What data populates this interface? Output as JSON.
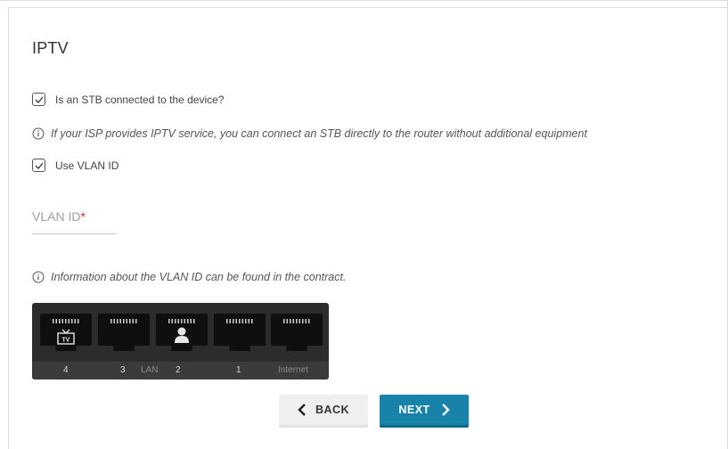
{
  "page": {
    "title": "IPTV"
  },
  "stb_option": {
    "label": "Is an STB connected to the device?",
    "checked": true
  },
  "isp_info": {
    "text": "If your ISP provides IPTV service, you can connect an STB directly to the router without additional equipment"
  },
  "vlan_option": {
    "label": "Use VLAN ID",
    "checked": true
  },
  "vlan_field": {
    "label": "VLAN ID",
    "required_mark": "*",
    "value": ""
  },
  "vlan_info": {
    "text": "Information about the VLAN ID can be found in the contract."
  },
  "ports": {
    "labels": {
      "p4": "4",
      "p3": "3",
      "lan": "LAN",
      "p2": "2",
      "p1": "1",
      "internet": "Internet"
    },
    "icons": {
      "p4": "tv-icon",
      "p2": "user-icon"
    }
  },
  "actions": {
    "back_label": "BACK",
    "next_label": "NEXT"
  },
  "colors": {
    "accent": "#1883aa",
    "required": "#d9262a",
    "panel": "#2c2c2c"
  }
}
